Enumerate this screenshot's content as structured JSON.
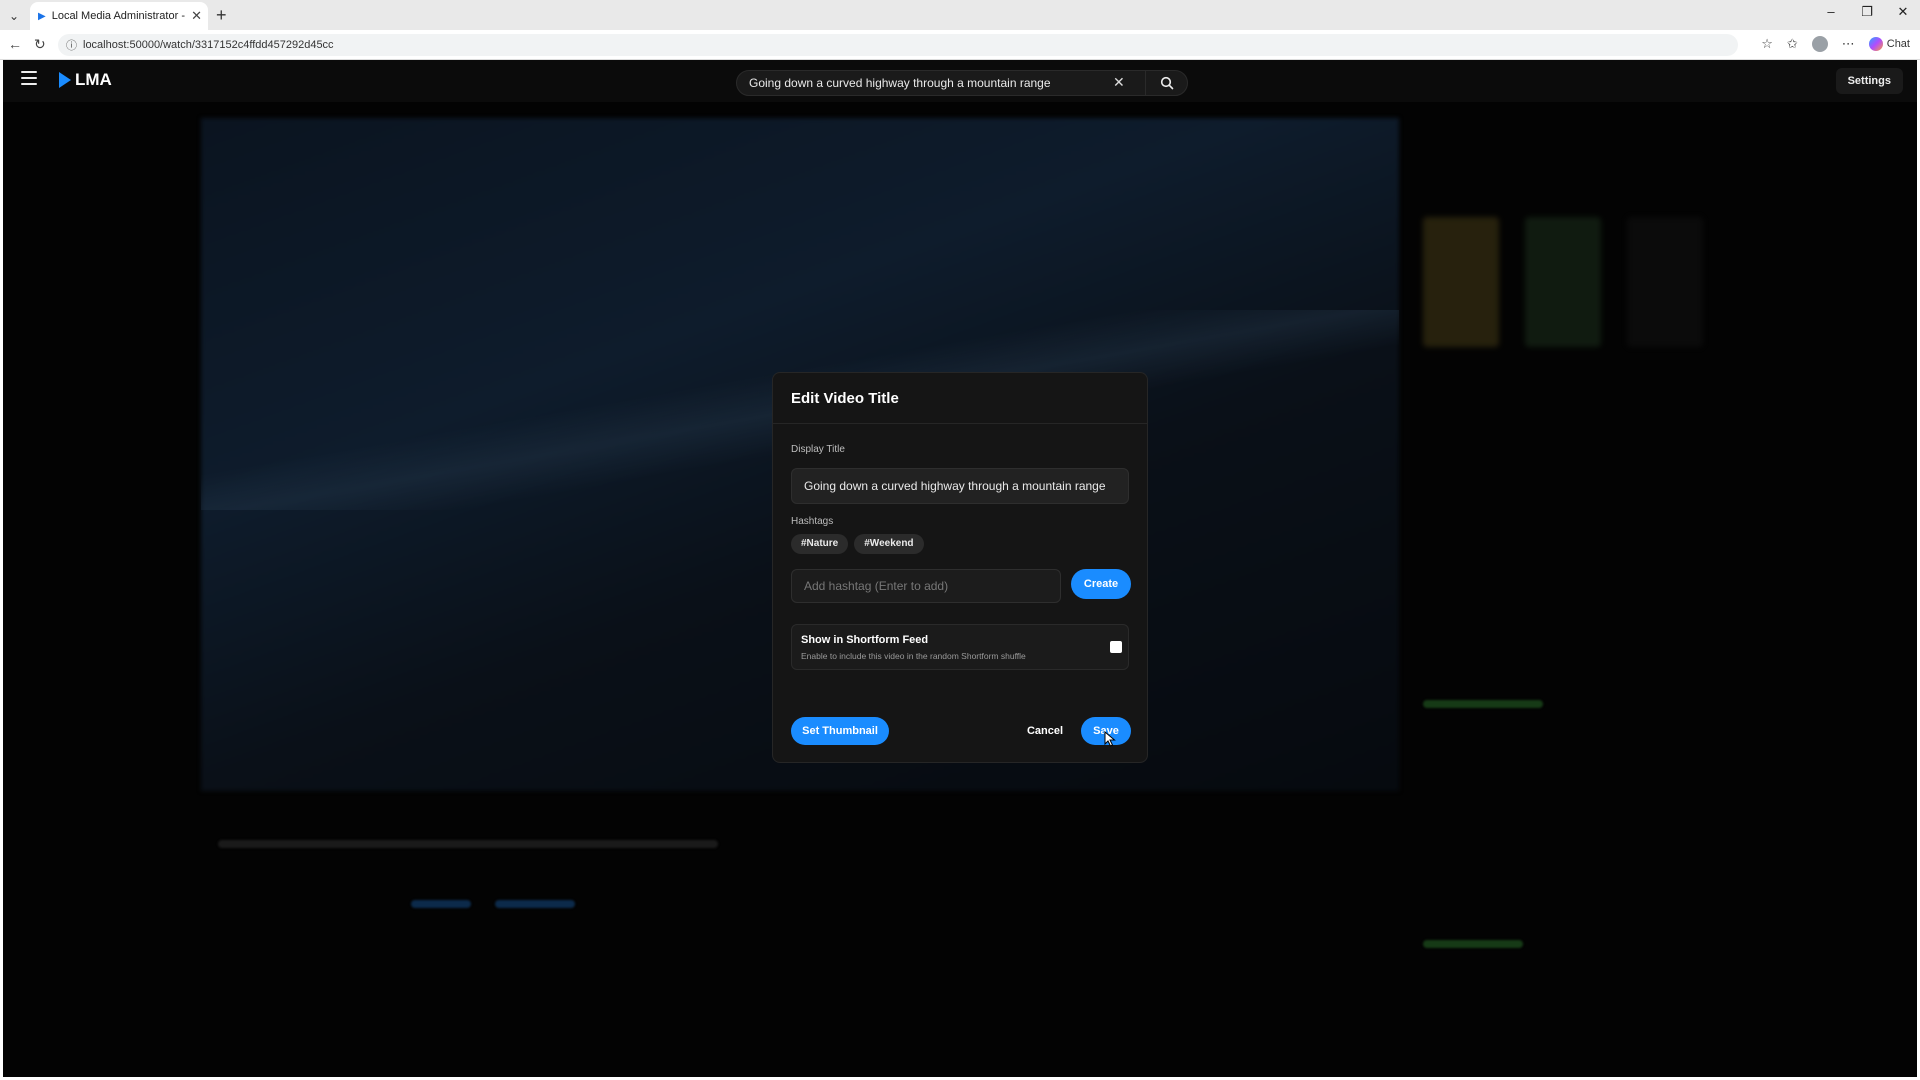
{
  "browser": {
    "tab_title": "Local Media Administrator - Video",
    "new_tab_symbol": "+",
    "url": "localhost:50000/watch/3317152c4ffdd457292d45cc",
    "chat_label": "Chat"
  },
  "header": {
    "brand": "LMA",
    "search_value": "Going down a curved highway through a mountain range",
    "settings_label": "Settings"
  },
  "modal": {
    "title": "Edit Video Title",
    "display_title_label": "Display Title",
    "display_title_value": "Going down a curved highway through a mountain range",
    "hashtags_label": "Hashtags",
    "hashtags": [
      "#Nature",
      "#Weekend"
    ],
    "hashtag_placeholder": "Add hashtag (Enter to add)",
    "create_label": "Create",
    "shortform_title": "Show in Shortform Feed",
    "shortform_desc": "Enable to include this video in the random Shortform shuffle",
    "shortform_checked": false,
    "set_thumbnail_label": "Set Thumbnail",
    "cancel_label": "Cancel",
    "save_label": "Save"
  },
  "colors": {
    "accent": "#1a8cff",
    "page_bg": "#030303",
    "modal_bg": "#151515"
  },
  "icons": {
    "menu": "hamburger-icon",
    "search": "search-icon",
    "clear": "close-icon",
    "back": "back-arrow-icon",
    "reload": "reload-icon"
  }
}
